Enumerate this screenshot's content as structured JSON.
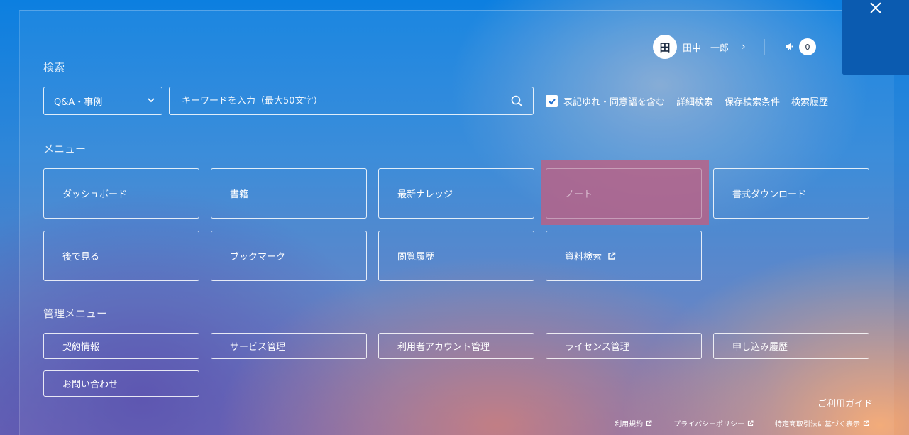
{
  "user": {
    "avatar_initial": "田",
    "name": "田中　一郎",
    "chevron": "›"
  },
  "notifications": {
    "count": "0"
  },
  "search": {
    "section_title": "検索",
    "category_value": "Q&A・事例",
    "placeholder": "キーワードを入力（最大50文字）",
    "checkbox_label": "表記ゆれ・同意語を含む",
    "advanced_search": "詳細検索",
    "saved_conditions": "保存検索条件",
    "history": "検索履歴"
  },
  "menu": {
    "section_title": "メニュー",
    "items": [
      {
        "label": "ダッシュボード"
      },
      {
        "label": "書籍"
      },
      {
        "label": "最新ナレッジ"
      },
      {
        "label": "ノート"
      },
      {
        "label": "書式ダウンロード"
      },
      {
        "label": "後で見る"
      },
      {
        "label": "ブックマーク"
      },
      {
        "label": "閲覧履歴"
      },
      {
        "label": "資料検索"
      }
    ]
  },
  "admin": {
    "section_title": "管理メニュー",
    "items": [
      {
        "label": "契約情報"
      },
      {
        "label": "サービス管理"
      },
      {
        "label": "利用者アカウント管理"
      },
      {
        "label": "ライセンス管理"
      },
      {
        "label": "申し込み履歴"
      },
      {
        "label": "お問い合わせ"
      }
    ]
  },
  "footer": {
    "guide": "ご利用ガイド",
    "terms": "利用規約",
    "privacy": "プライバシーポリシー",
    "commerce": "特定商取引法に基づく表示"
  },
  "icons": {
    "close": "close-icon",
    "notification": "megaphone-icon",
    "search": "search-icon",
    "external": "external-link-icon",
    "check": "check-icon"
  }
}
